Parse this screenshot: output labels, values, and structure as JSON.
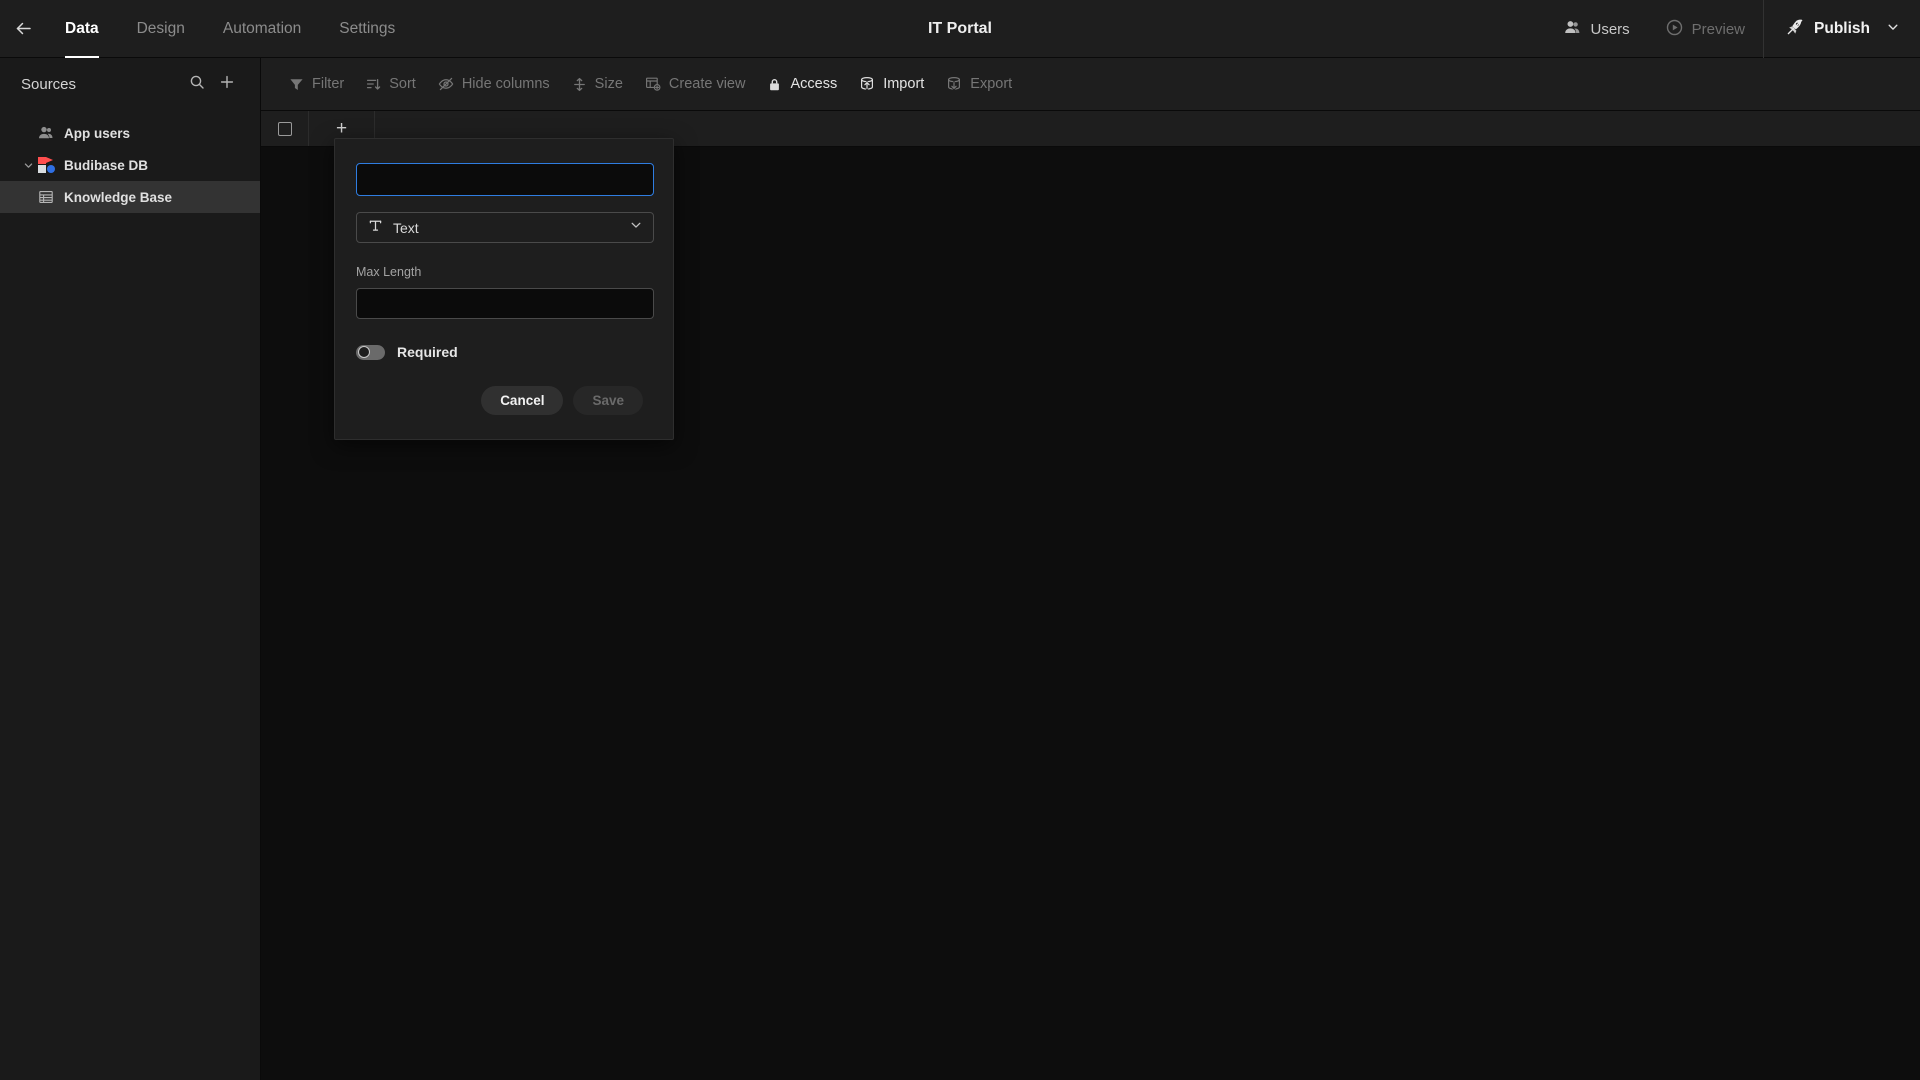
{
  "header": {
    "back_icon": "arrow-left-icon",
    "app_title": "IT Portal",
    "tabs": [
      {
        "label": "Data",
        "active": true
      },
      {
        "label": "Design",
        "active": false
      },
      {
        "label": "Automation",
        "active": false
      },
      {
        "label": "Settings",
        "active": false
      }
    ],
    "users_label": "Users",
    "users_icon": "users-icon",
    "preview_label": "Preview",
    "preview_icon": "play-circle-icon",
    "publish_label": "Publish",
    "publish_icon": "rocket-icon",
    "publish_chevron_icon": "chevron-down-icon"
  },
  "sidebar": {
    "title": "Sources",
    "search_icon": "search-icon",
    "add_icon": "plus-icon",
    "items": [
      {
        "label": "App users",
        "icon": "users-icon",
        "selected": false,
        "child": false
      },
      {
        "label": "Budibase DB",
        "icon": "budibase-logo-icon",
        "selected": false,
        "child": false,
        "expanded": true
      },
      {
        "label": "Knowledge Base",
        "icon": "table-icon",
        "selected": true,
        "child": true
      }
    ]
  },
  "toolbar": {
    "buttons": [
      {
        "label": "Filter",
        "icon": "filter-icon",
        "bright": false
      },
      {
        "label": "Sort",
        "icon": "sort-icon",
        "bright": false
      },
      {
        "label": "Hide columns",
        "icon": "eye-off-icon",
        "bright": false
      },
      {
        "label": "Size",
        "icon": "row-height-icon",
        "bright": false
      },
      {
        "label": "Create view",
        "icon": "create-view-icon",
        "bright": false
      },
      {
        "label": "Access",
        "icon": "lock-icon",
        "bright": true
      },
      {
        "label": "Import",
        "icon": "import-icon",
        "bright": true
      },
      {
        "label": "Export",
        "icon": "export-icon",
        "bright": false
      }
    ]
  },
  "grid": {
    "select_all_icon": "checkbox-icon",
    "add_column_icon": "plus-icon"
  },
  "modal": {
    "name_value": "",
    "name_placeholder": "",
    "type_value": "Text",
    "type_icon": "text-type-icon",
    "type_chevron_icon": "chevron-down-icon",
    "max_length_label": "Max Length",
    "max_length_value": "",
    "required_label": "Required",
    "required_on": false,
    "cancel_label": "Cancel",
    "save_label": "Save",
    "save_disabled": true
  },
  "colors": {
    "accent_focus": "#2f7de1",
    "panel_bg": "#1e1e1e",
    "sidebar_bg": "#1a1a1a",
    "grid_bg": "#0d0d0d",
    "selected_row": "#333333",
    "logo_red": "#ff4e4e",
    "logo_blue": "#2f6fe4"
  }
}
